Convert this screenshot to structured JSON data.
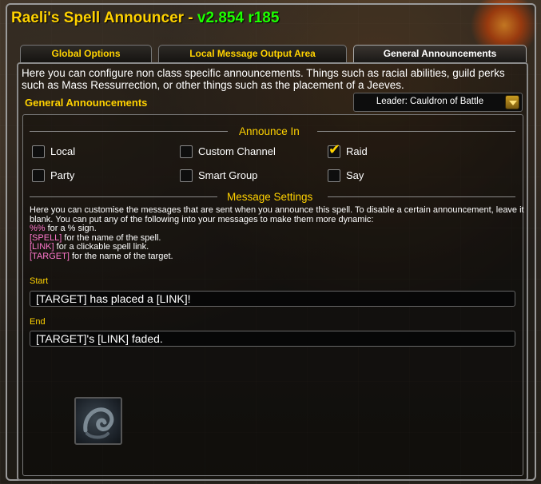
{
  "window": {
    "title": "Raeli's Spell Announcer - ",
    "version": "v2.854 r185"
  },
  "tabs": [
    {
      "label": "Global Options",
      "active": false
    },
    {
      "label": "Local Message Output Area",
      "active": false
    },
    {
      "label": "General Announcements",
      "active": true
    }
  ],
  "intro_text": "Here you can configure non class specific announcements. Things such as racial abilities, guild perks such as Mass Ressurrection, or other things such as the placement of a Jeeves.",
  "section_title": "General Announcements",
  "spell_dropdown": {
    "selected": "Leader: Cauldron of Battle"
  },
  "announce_in": {
    "header": "Announce In",
    "options": [
      {
        "label": "Local",
        "checked": false
      },
      {
        "label": "Custom Channel",
        "checked": false
      },
      {
        "label": "Raid",
        "checked": true
      },
      {
        "label": "Party",
        "checked": false
      },
      {
        "label": "Smart Group",
        "checked": false
      },
      {
        "label": "Say",
        "checked": false
      }
    ]
  },
  "message_settings": {
    "header": "Message Settings",
    "description": "Here you can customise the messages that are sent when you announce this spell. To disable a certain announcement, leave it blank. You can put any of the following into your messages to make them more dynamic:",
    "tokens": [
      {
        "token": "%%",
        "text": " for a % sign."
      },
      {
        "token": "[SPELL]",
        "text": " for the name of the spell."
      },
      {
        "token": "[LINK]",
        "text": " for a clickable spell link."
      },
      {
        "token": "[TARGET]",
        "text": " for the name of the target."
      }
    ],
    "start_label": "Start",
    "start_value": "[TARGET] has placed a [LINK]!",
    "end_label": "End",
    "end_value": "[TARGET]'s [LINK] faded."
  },
  "colors": {
    "gold": "#ffd200",
    "version_green": "#1eff00",
    "token_pink": "#ff77cc"
  }
}
